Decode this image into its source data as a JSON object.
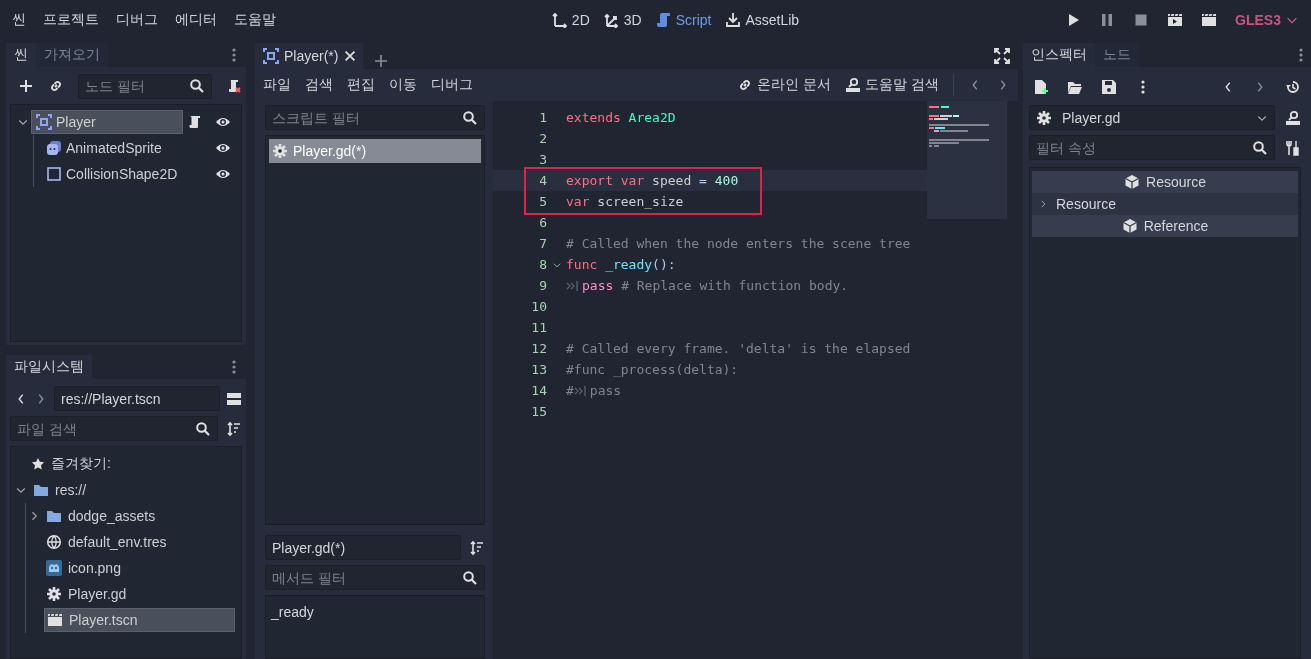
{
  "menu": [
    {
      "label": "씬"
    },
    {
      "label": "프로젝트"
    },
    {
      "label": "디버그"
    },
    {
      "label": "에디터"
    },
    {
      "label": "도움말"
    }
  ],
  "workspaces": [
    {
      "label": "2D",
      "kind": "planar",
      "selected": false
    },
    {
      "label": "3D",
      "kind": "spatial",
      "selected": false
    },
    {
      "label": "Script",
      "kind": "script",
      "selected": true
    },
    {
      "label": "AssetLib",
      "kind": "assetlib",
      "selected": false
    }
  ],
  "renderer": "GLES3",
  "scene_dock": {
    "tabs": [
      {
        "label": "씬",
        "selected": true
      },
      {
        "label": "가져오기",
        "selected": false
      }
    ],
    "filter": {
      "placeholder": "노드 필터"
    },
    "tree": [
      {
        "name": "Player",
        "kind": "area",
        "selected": true,
        "expanded": true,
        "has_script": true,
        "children": [
          {
            "name": "AnimatedSprite",
            "kind": "sprite",
            "selected": false,
            "has_script": false
          },
          {
            "name": "CollisionShape2D",
            "kind": "shape",
            "selected": false,
            "has_script": false
          }
        ]
      }
    ]
  },
  "filesystem": {
    "tab": "파일시스템",
    "path": "res://Player.tscn",
    "search": {
      "placeholder": "파일 검색"
    },
    "favorites": "즐겨찾기:",
    "tree": [
      {
        "name": "res://",
        "kind": "folder",
        "expanded": true,
        "selected": false,
        "children": [
          {
            "name": "dodge_assets",
            "kind": "folder",
            "expanded": false,
            "selected": false
          },
          {
            "name": "default_env.tres",
            "kind": "environment",
            "selected": false
          },
          {
            "name": "icon.png",
            "kind": "image",
            "selected": false
          },
          {
            "name": "Player.gd",
            "kind": "script",
            "selected": false
          },
          {
            "name": "Player.tscn",
            "kind": "scene",
            "selected": true
          }
        ]
      }
    ]
  },
  "editor": {
    "tabs": [
      {
        "label": "Player(*)",
        "selected": true
      }
    ],
    "menu": [
      {
        "label": "파일"
      },
      {
        "label": "검색"
      },
      {
        "label": "편집"
      },
      {
        "label": "이동"
      },
      {
        "label": "디버그"
      }
    ],
    "links": [
      {
        "label": "온라인 문서",
        "kind": "online"
      },
      {
        "label": "도움말 검색",
        "kind": "help"
      }
    ],
    "script_filter": {
      "placeholder": "스크립트 필터"
    },
    "scripts": [
      {
        "name": "Player.gd(*)",
        "selected": true
      }
    ],
    "current_script": "Player.gd(*)",
    "method_filter": {
      "placeholder": "메서드 필터"
    },
    "methods": [
      {
        "name": "_ready"
      }
    ],
    "lines": [
      {
        "number": "1",
        "current": false,
        "boxed": false,
        "fold": false,
        "tokens": [
          {
            "text": "extends",
            "kind": "keyword"
          },
          {
            "text": " Area2D",
            "kind": "type"
          }
        ]
      },
      {
        "number": "2",
        "current": false,
        "boxed": false,
        "fold": false
      },
      {
        "number": "3",
        "current": false,
        "boxed": false,
        "fold": false
      },
      {
        "number": "4",
        "current": true,
        "boxed": true,
        "fold": false,
        "tokens": [
          {
            "text": "export var",
            "kind": "keyword"
          },
          {
            "text": " speed ",
            "kind": "plain"
          },
          {
            "text": "=",
            "kind": "symbol"
          },
          {
            "text": " 400",
            "kind": "number"
          }
        ]
      },
      {
        "number": "5",
        "current": false,
        "boxed": true,
        "fold": false,
        "tokens": [
          {
            "text": "var",
            "kind": "keyword"
          },
          {
            "text": " screen_size",
            "kind": "plain"
          }
        ]
      },
      {
        "number": "6",
        "current": false,
        "boxed": false,
        "fold": false
      },
      {
        "number": "7",
        "current": false,
        "boxed": false,
        "fold": false,
        "tokens": [
          {
            "text": "# Called when the node enters the scene tree",
            "kind": "comment"
          }
        ]
      },
      {
        "number": "8",
        "current": false,
        "boxed": false,
        "fold": true,
        "tokens": [
          {
            "text": "func",
            "kind": "keyword"
          },
          {
            "text": " _ready",
            "kind": "function"
          },
          {
            "text": "():",
            "kind": "symbol"
          }
        ]
      },
      {
        "number": "9",
        "current": false,
        "boxed": false,
        "fold": false,
        "tokens": [
          {
            "kind": "tab"
          },
          {
            "text": "pass",
            "kind": "control"
          },
          {
            "text": " # Replace with function body.",
            "kind": "comment"
          }
        ]
      },
      {
        "number": "10",
        "current": false,
        "boxed": false,
        "fold": false
      },
      {
        "number": "11",
        "current": false,
        "boxed": false,
        "fold": false
      },
      {
        "number": "12",
        "current": false,
        "boxed": false,
        "fold": false,
        "tokens": [
          {
            "text": "# Called every frame. 'delta' is the elapsed",
            "kind": "comment"
          }
        ]
      },
      {
        "number": "13",
        "current": false,
        "boxed": false,
        "fold": false,
        "tokens": [
          {
            "text": "#func _process(delta):",
            "kind": "comment"
          }
        ]
      },
      {
        "number": "14",
        "current": false,
        "boxed": false,
        "fold": false,
        "tokens": [
          {
            "text": "#",
            "kind": "comment"
          },
          {
            "kind": "tab"
          },
          {
            "text": "pass",
            "kind": "comment"
          }
        ]
      },
      {
        "number": "15",
        "current": false,
        "boxed": false,
        "fold": false
      }
    ]
  },
  "inspector": {
    "tabs": [
      {
        "label": "인스펙터",
        "selected": true
      },
      {
        "label": "노드",
        "selected": false
      }
    ],
    "resource": "Player.gd",
    "filter": {
      "placeholder": "필터 속성"
    },
    "sections": [
      {
        "kind": "category",
        "label": "Resource"
      },
      {
        "kind": "group",
        "label": "Resource",
        "expanded": false
      },
      {
        "kind": "category",
        "label": "Reference"
      }
    ]
  }
}
